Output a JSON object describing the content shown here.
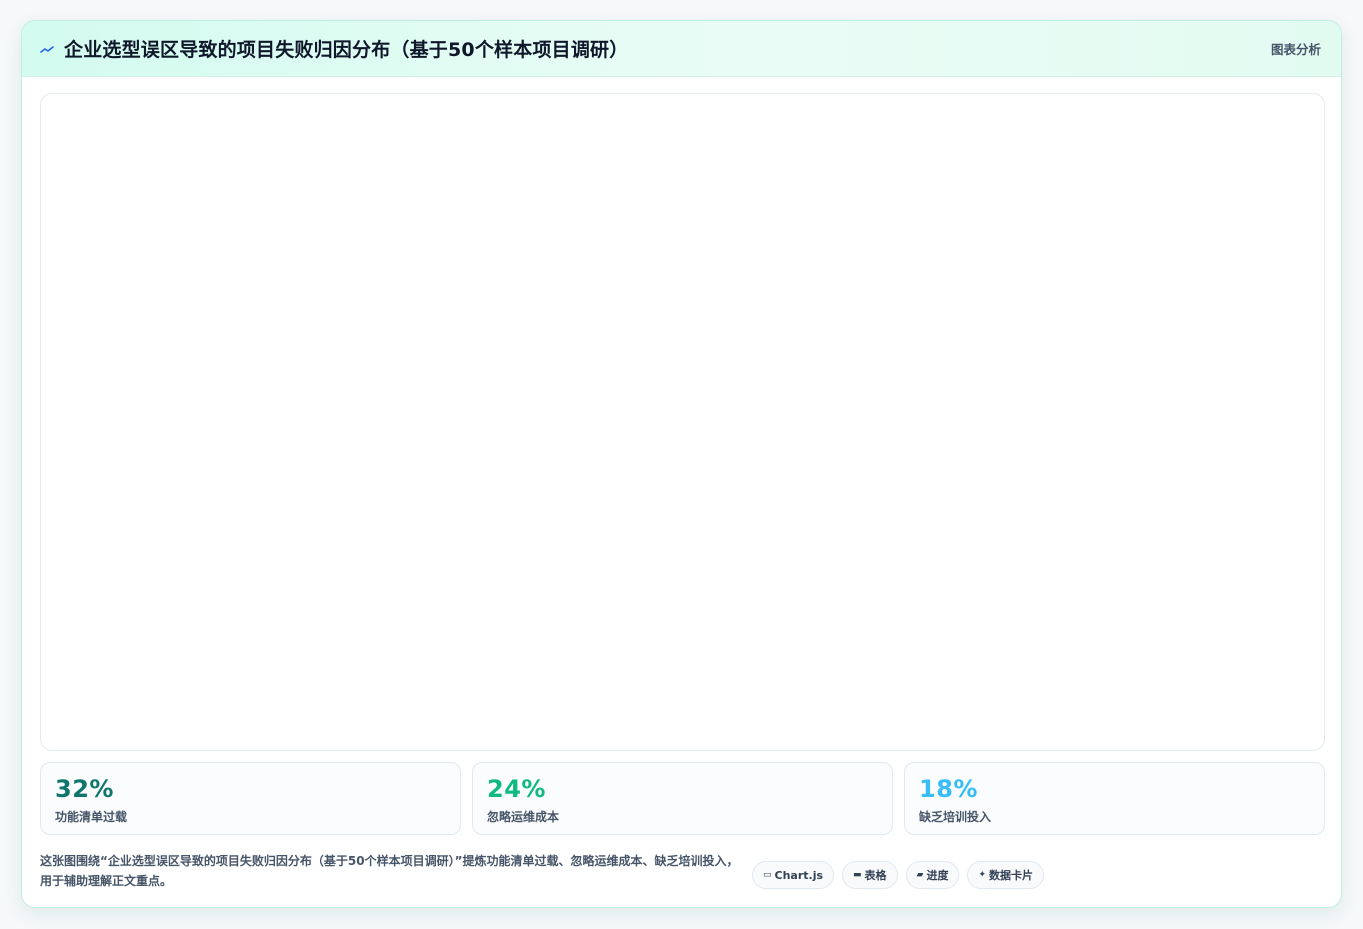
{
  "header": {
    "title": "企业选型误区导致的项目失败归因分布（基于50个样本项目调研）",
    "tag": "图表分析",
    "icon": "chart-line-icon",
    "accent": "#2563eb"
  },
  "stats": [
    {
      "value": "32%",
      "label": "功能清单过载",
      "color": "#0f766e"
    },
    {
      "value": "24%",
      "label": "忽略运维成本",
      "color": "#10b981"
    },
    {
      "value": "18%",
      "label": "缺乏培训投入",
      "color": "#38bdf8"
    }
  ],
  "footer": {
    "description": "这张图围绕“企业选型误区导致的项目失败归因分布（基于50个样本项目调研）”提炼功能清单过载、忽略运维成本、缺乏培训投入，用于辅助理解正文重点。",
    "chips": [
      {
        "icon": "▭",
        "icon_name": "chart-icon",
        "label": "Chart.js"
      },
      {
        "icon": "▬",
        "icon_name": "table-icon",
        "label": "表格"
      },
      {
        "icon": "▰",
        "icon_name": "progress-icon",
        "label": "进度"
      },
      {
        "icon": "✦",
        "icon_name": "sparkle-icon",
        "label": "数据卡片"
      }
    ]
  }
}
